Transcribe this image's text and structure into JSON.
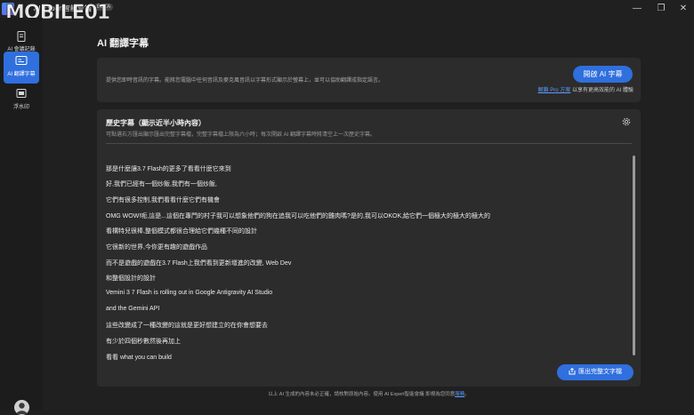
{
  "app": {
    "name": "AI Expert智能會議",
    "badge": "BETA",
    "watermark": "MOBILE01"
  },
  "window_controls": {
    "minimize": "—",
    "maximize": "❐",
    "close": "✕"
  },
  "sidebar": {
    "items": [
      {
        "label": "AI 會議記錄",
        "icon": "document-icon",
        "active": false
      },
      {
        "label": "AI 翻譯字幕",
        "icon": "translate-icon",
        "active": true
      },
      {
        "label": "浮水印",
        "icon": "watermark-icon",
        "active": false
      }
    ]
  },
  "page": {
    "title": "AI 翻譯字幕"
  },
  "intro": {
    "description": "提供您即時音訊的字幕。能將您電腦中任何音訊及麥克風音訊以字幕形式顯示於螢幕上，並可以協助翻譯成指定語言。",
    "start_button": "開啟 AI 字幕",
    "pro_link": "解鎖 Pro 方案",
    "pro_suffix": "以享有更高效能的 AI 體驗"
  },
  "history": {
    "title": "歷史字幕（顯示近半小時內容）",
    "note": "可點選右方匯出顯示匯出完整字幕檔，完整字幕檔上限為六小時；每次開啟 AI 翻譯字幕時將清空上一次歷史字幕。",
    "lines": [
      "那是什麼讓3.7 Flash的更多了看看什麼它來到",
      "好,我們已經有一個炒飯,我們有一個炒飯,",
      "它們有很多控制,我們看看什麼它們有機會",
      "OMG WOW!呃,這是...這個在專門的村子我可以想象他們的狗在追我可以吃他們的雞肉嗎?是的,我可以OKOK,給它們一個極大的極大的極大的",
      "看構特兒很棒,整個模式都很合理給它們幾種不同的設計",
      "它很新的世界,今你更有趣的遊戲作品",
      "而不是遊戲的遊戲在3.7 Flash上我們看到更新增進的改變, Web Dev",
      "和整個設計的設計",
      "Vemini 3 7 Flash is rolling out in Google Antigravity AI Studio",
      "and the Gemini API",
      "這些改變成了一種改變的這就是更好想建立的在你會想要去",
      "有少於四個秒數然後再加上",
      "看看 what you can build"
    ],
    "export_button": "匯出完整文字檔"
  },
  "footer": {
    "text": "以上 AI 生成的內容未必正確，請核對原始內容。使用 AI Expert智能會議 即視為您同意",
    "link": "服務"
  },
  "colors": {
    "accent": "#2f6fde",
    "link": "#5a9bff",
    "background": "#202020",
    "card": "#2c2c2c"
  }
}
